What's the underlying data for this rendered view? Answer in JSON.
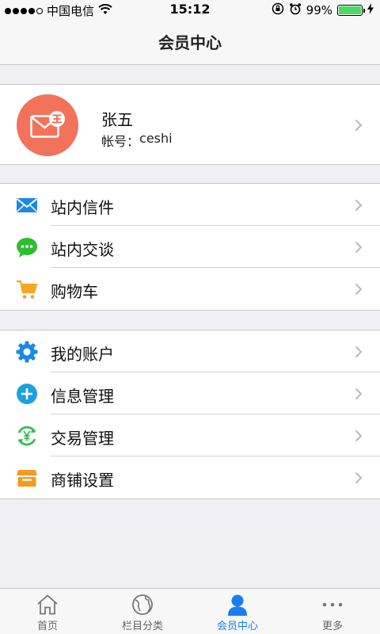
{
  "status_bar": {
    "carrier": "中国电信",
    "time": "15:12",
    "battery_percent": "99%",
    "battery_level": 0.99,
    "signal_bars": 4
  },
  "header": {
    "title": "会员中心"
  },
  "profile": {
    "name": "张五",
    "account_label": "帐号：",
    "account_value": "ceshi",
    "avatar_icon": "mail-envelope-icon",
    "avatar_color": "#f2735a"
  },
  "menu_group_1": [
    {
      "label": "站内信件",
      "icon": "envelope-icon",
      "color": "#1e88e5"
    },
    {
      "label": "站内交谈",
      "icon": "chat-bubble-icon",
      "color": "#2ebd2e"
    },
    {
      "label": "购物车",
      "icon": "shopping-cart-icon",
      "color": "#f5a623"
    }
  ],
  "menu_group_2": [
    {
      "label": "我的账户",
      "icon": "gear-icon",
      "color": "#1e88e5"
    },
    {
      "label": "信息管理",
      "icon": "plus-circle-icon",
      "color": "#1ba1e2"
    },
    {
      "label": "交易管理",
      "icon": "yen-refresh-icon",
      "color": "#2ebd4e"
    },
    {
      "label": "商铺设置",
      "icon": "store-icon",
      "color": "#f59a23"
    }
  ],
  "tab_bar": {
    "active_color": "#1a7df0",
    "tabs": [
      {
        "label": "首页",
        "icon": "home-icon"
      },
      {
        "label": "栏目分类",
        "icon": "globe-icon"
      },
      {
        "label": "会员中心",
        "icon": "user-icon"
      },
      {
        "label": "更多",
        "icon": "more-dots-icon"
      }
    ]
  }
}
